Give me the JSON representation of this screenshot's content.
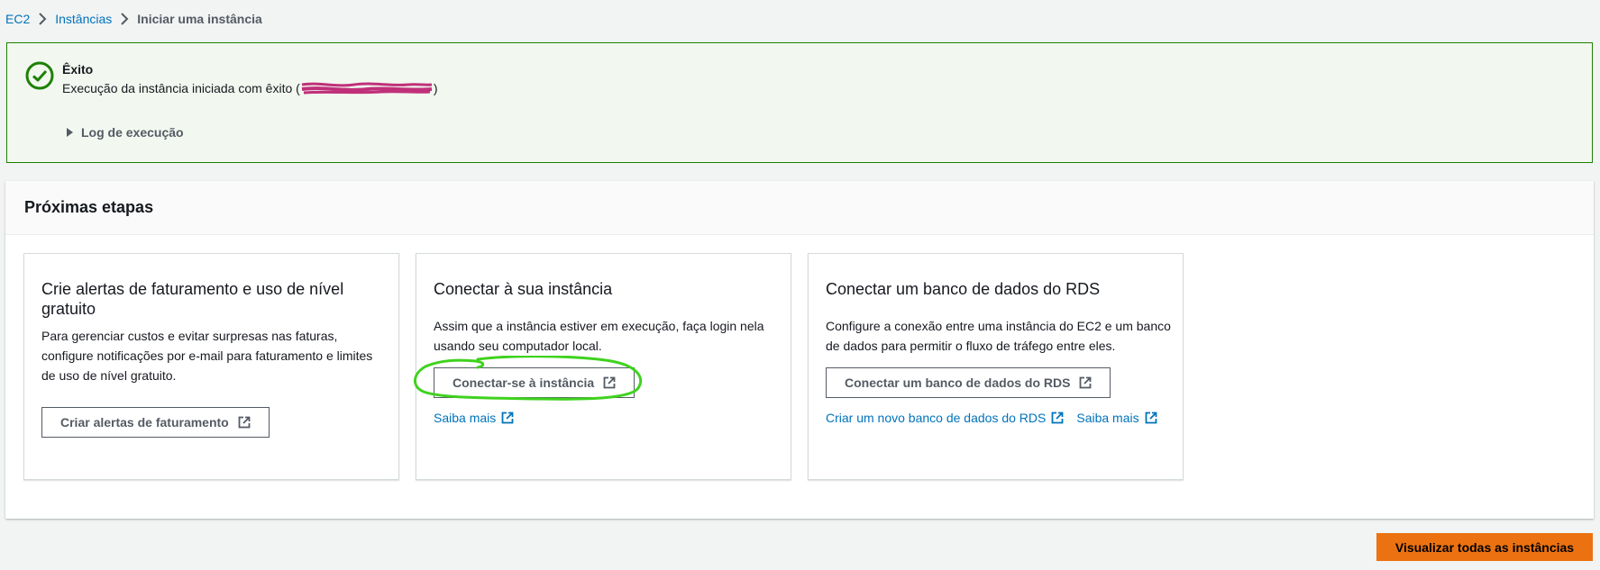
{
  "breadcrumb": {
    "items": [
      {
        "label": "EC2"
      },
      {
        "label": "Instâncias"
      },
      {
        "label": "Iniciar uma instância"
      }
    ]
  },
  "flash": {
    "type": "success",
    "title": "Êxito",
    "message_prefix": "Execução da instância iniciada com êxito (",
    "message_suffix": ")",
    "log_toggle_label": "Log de execução"
  },
  "next_steps": {
    "header": "Próximas etapas",
    "cards": [
      {
        "title": "Crie alertas de faturamento e uso de nível gratuito",
        "description": "Para gerenciar custos e evitar surpresas nas faturas, configure notificações por e-mail para faturamento e limites de uso de nível gratuito.",
        "button_label": "Criar alertas de faturamento"
      },
      {
        "title": "Conectar à sua instância",
        "description": "Assim que a instância estiver em execução, faça login nela usando seu computador local.",
        "button_label": "Conectar-se à instância",
        "links": [
          {
            "label": "Saiba mais"
          }
        ]
      },
      {
        "title": "Conectar um banco de dados do RDS",
        "description": "Configure a conexão entre uma instância do EC2 e um banco de dados para permitir o fluxo de tráfego entre eles.",
        "button_label": "Conectar um banco de dados do RDS",
        "links": [
          {
            "label": "Criar um novo banco de dados do RDS"
          },
          {
            "label": "Saiba mais"
          }
        ]
      }
    ]
  },
  "footer": {
    "primary_button_label": "Visualizar todas as instâncias"
  },
  "icons": {
    "success": "check-circle-icon",
    "external": "external-link-icon",
    "breadcrumb_separator": "chevron-right-icon"
  },
  "colors": {
    "success_border": "#1d8102",
    "success_bg": "#f2f8f0",
    "link": "#0073bb",
    "primary_button": "#ec7211",
    "annotation": "#3fd21f",
    "redaction": "#c0307a"
  }
}
